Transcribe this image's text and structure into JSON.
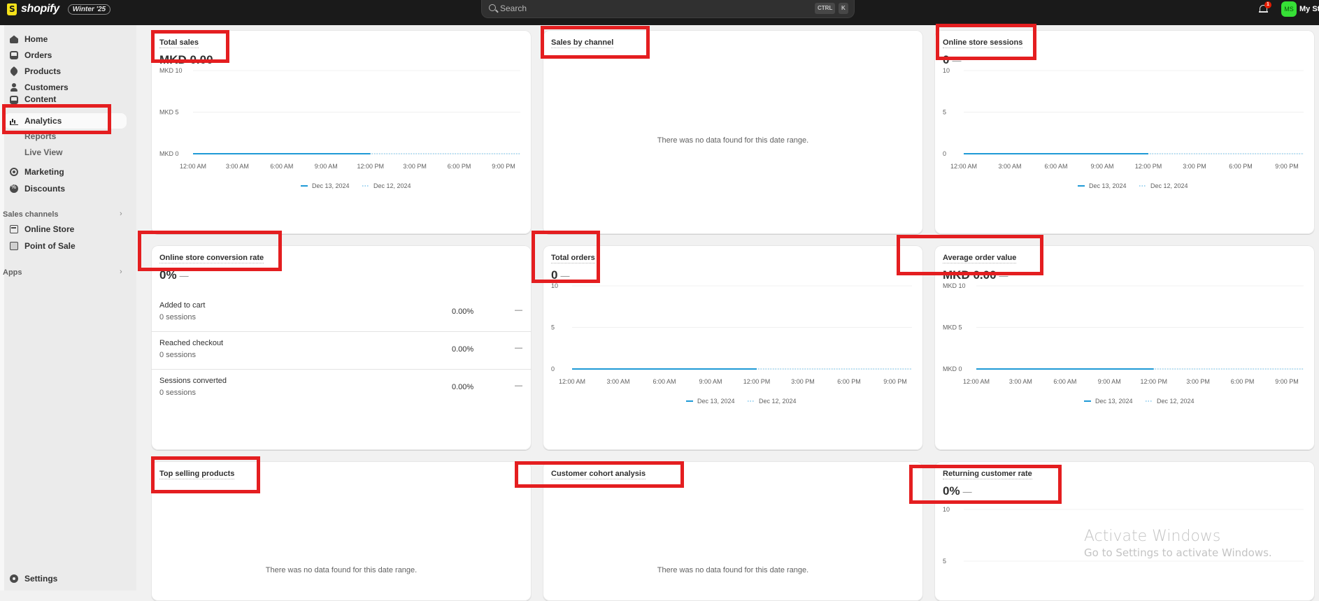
{
  "topbar": {
    "brand": "shopify",
    "edition_badge": "Winter '25",
    "search_placeholder": "Search",
    "shortcut_keys": [
      "CTRL",
      "K"
    ],
    "notification_count": "1",
    "avatar_initials": "MS",
    "store_name": "My St"
  },
  "sidebar": {
    "items": [
      {
        "label": "Home",
        "icon": "home-icon"
      },
      {
        "label": "Orders",
        "icon": "orders-icon"
      },
      {
        "label": "Products",
        "icon": "tag-icon"
      },
      {
        "label": "Customers",
        "icon": "person-icon"
      },
      {
        "label": "Content",
        "icon": "content-icon"
      },
      {
        "label": "Analytics",
        "icon": "bar-chart-icon",
        "active": true
      },
      {
        "label": "Marketing",
        "icon": "target-icon"
      },
      {
        "label": "Discounts",
        "icon": "discount-icon"
      }
    ],
    "analytics_sub": [
      "Reports",
      "Live View"
    ],
    "sales_channels_label": "Sales channels",
    "sales_channels": [
      {
        "label": "Online Store",
        "icon": "store-icon"
      },
      {
        "label": "Point of Sale",
        "icon": "pos-icon"
      }
    ],
    "apps_label": "Apps",
    "settings_label": "Settings"
  },
  "time_ticks": [
    "12:00 AM",
    "3:00 AM",
    "6:00 AM",
    "9:00 AM",
    "12:00 PM",
    "3:00 PM",
    "6:00 PM",
    "9:00 PM"
  ],
  "legend": {
    "current": "Dec 13, 2024",
    "previous": "Dec 12, 2024"
  },
  "colors": {
    "current_line": "#1f9ad6",
    "previous_line": "#7fc6ec",
    "annotation": "#e41e20"
  },
  "no_data_message": "There was no data found for this date range.",
  "cards": {
    "total_sales": {
      "title": "Total sales",
      "value": "MKD 0.00"
    },
    "sales_by_channel": {
      "title": "Sales by channel"
    },
    "online_store_sessions": {
      "title": "Online store sessions",
      "value": "0"
    },
    "conversion_rate": {
      "title": "Online store conversion rate",
      "value": "0%",
      "rows": [
        {
          "label": "Added to cart",
          "sessions": "0 sessions",
          "pct": "0.00%",
          "change": "—"
        },
        {
          "label": "Reached checkout",
          "sessions": "0 sessions",
          "pct": "0.00%",
          "change": "—"
        },
        {
          "label": "Sessions converted",
          "sessions": "0 sessions",
          "pct": "0.00%",
          "change": "—"
        }
      ]
    },
    "total_orders": {
      "title": "Total orders",
      "value": "0"
    },
    "average_order_value": {
      "title": "Average order value",
      "value": "MKD 0.00"
    },
    "top_selling_products": {
      "title": "Top selling products"
    },
    "customer_cohort_analysis": {
      "title": "Customer cohort analysis"
    },
    "returning_customer_rate": {
      "title": "Returning customer rate",
      "value": "0%"
    }
  },
  "chart_data": [
    {
      "type": "line",
      "title": "Total sales",
      "x": [
        "12:00 AM",
        "3:00 AM",
        "6:00 AM",
        "9:00 AM",
        "12:00 PM",
        "3:00 PM",
        "6:00 PM",
        "9:00 PM"
      ],
      "ytick_labels": [
        "MKD 0",
        "MKD 5",
        "MKD 10"
      ],
      "ylim": [
        0,
        10
      ],
      "series": [
        {
          "name": "Dec 13, 2024",
          "values": [
            0,
            0,
            0,
            0,
            0
          ]
        },
        {
          "name": "Dec 12, 2024",
          "values": [
            0,
            0,
            0,
            0,
            0,
            0,
            0,
            0
          ]
        }
      ],
      "legend": "bottom"
    },
    {
      "type": "line",
      "title": "Online store sessions",
      "x": [
        "12:00 AM",
        "3:00 AM",
        "6:00 AM",
        "9:00 AM",
        "12:00 PM",
        "3:00 PM",
        "6:00 PM",
        "9:00 PM"
      ],
      "ytick_labels": [
        "0",
        "5",
        "10"
      ],
      "ylim": [
        0,
        10
      ],
      "series": [
        {
          "name": "Dec 13, 2024",
          "values": [
            0,
            0,
            0,
            0,
            0
          ]
        },
        {
          "name": "Dec 12, 2024",
          "values": [
            0,
            0,
            0,
            0,
            0,
            0,
            0,
            0
          ]
        }
      ],
      "legend": "bottom"
    },
    {
      "type": "line",
      "title": "Total orders",
      "x": [
        "12:00 AM",
        "3:00 AM",
        "6:00 AM",
        "9:00 AM",
        "12:00 PM",
        "3:00 PM",
        "6:00 PM",
        "9:00 PM"
      ],
      "ytick_labels": [
        "0",
        "5",
        "10"
      ],
      "ylim": [
        0,
        10
      ],
      "series": [
        {
          "name": "Dec 13, 2024",
          "values": [
            0,
            0,
            0,
            0,
            0
          ]
        },
        {
          "name": "Dec 12, 2024",
          "values": [
            0,
            0,
            0,
            0,
            0,
            0,
            0,
            0
          ]
        }
      ],
      "legend": "bottom"
    },
    {
      "type": "line",
      "title": "Average order value",
      "x": [
        "12:00 AM",
        "3:00 AM",
        "6:00 AM",
        "9:00 AM",
        "12:00 PM",
        "3:00 PM",
        "6:00 PM",
        "9:00 PM"
      ],
      "ytick_labels": [
        "MKD 0",
        "MKD 5",
        "MKD 10"
      ],
      "ylim": [
        0,
        10
      ],
      "series": [
        {
          "name": "Dec 13, 2024",
          "values": [
            0,
            0,
            0,
            0,
            0
          ]
        },
        {
          "name": "Dec 12, 2024",
          "values": [
            0,
            0,
            0,
            0,
            0,
            0,
            0,
            0
          ]
        }
      ],
      "legend": "bottom"
    },
    {
      "type": "line",
      "title": "Returning customer rate",
      "ytick_labels": [
        "5",
        "10"
      ],
      "ylim": [
        0,
        10
      ],
      "series": []
    }
  ],
  "watermark": {
    "line1": "Activate Windows",
    "line2": "Go to Settings to activate Windows."
  }
}
